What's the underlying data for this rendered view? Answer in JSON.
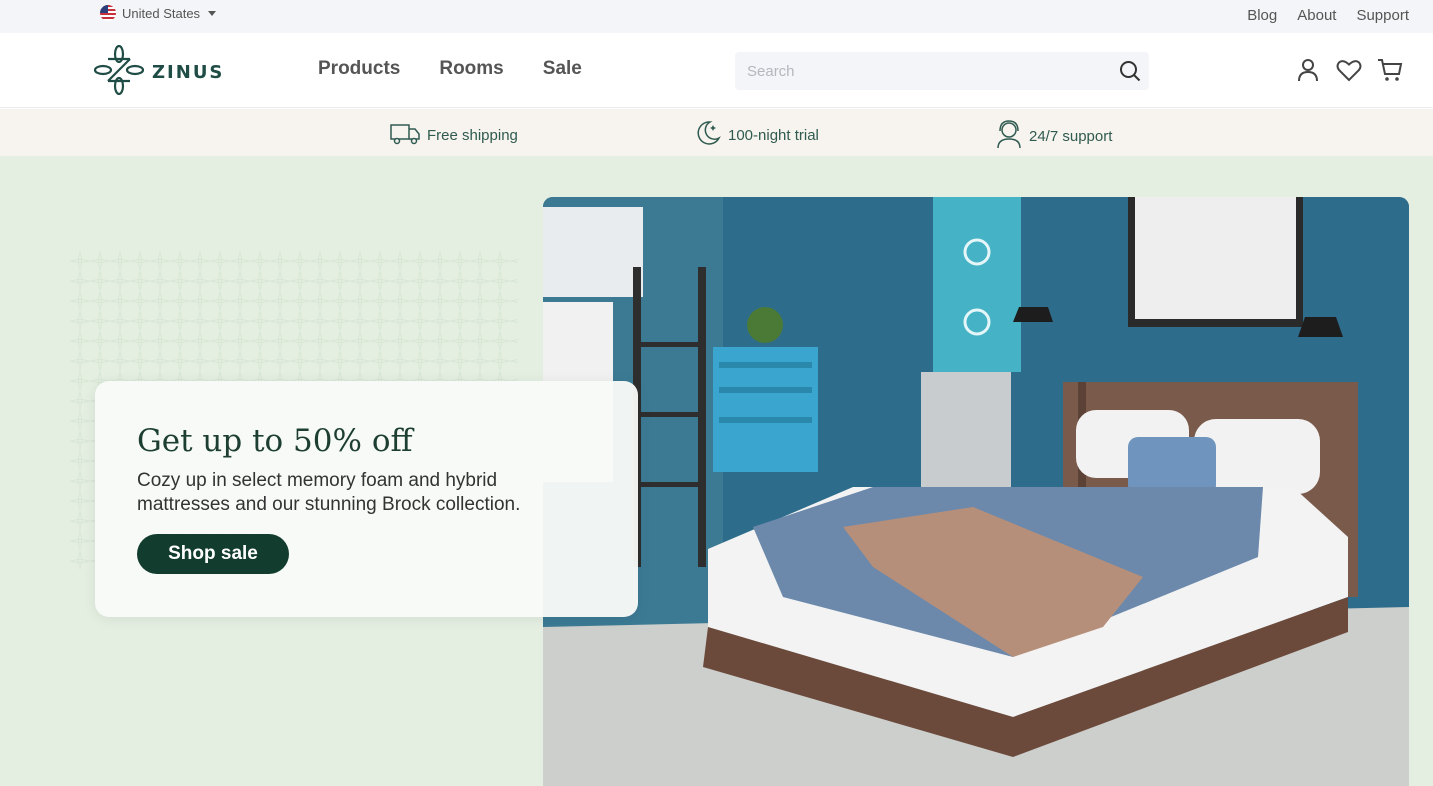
{
  "utility": {
    "locale": "United States",
    "links": [
      "Blog",
      "About",
      "Support"
    ]
  },
  "header": {
    "logo_text": "ZINUS",
    "nav": [
      "Products",
      "Rooms",
      "Sale"
    ],
    "search_placeholder": "Search",
    "icons": [
      "account-icon",
      "wishlist-heart-icon",
      "cart-icon"
    ]
  },
  "benefits": [
    {
      "icon": "delivery-truck-icon",
      "label": "Free shipping"
    },
    {
      "icon": "moon-stars-icon",
      "label": "100-night trial"
    },
    {
      "icon": "support-agent-icon",
      "label": "24/7 support"
    }
  ],
  "hero": {
    "title": "Get up to 50% off",
    "text": "Cozy up in select memory foam and hybrid mattresses and our stunning Brock collection.",
    "cta": "Shop sale"
  },
  "colors": {
    "brand_dark_green": "#123c2e",
    "hero_bg": "#e4efe2",
    "benefits_bg": "#f7f4ef",
    "wall_blue": "#2f6f8f"
  }
}
